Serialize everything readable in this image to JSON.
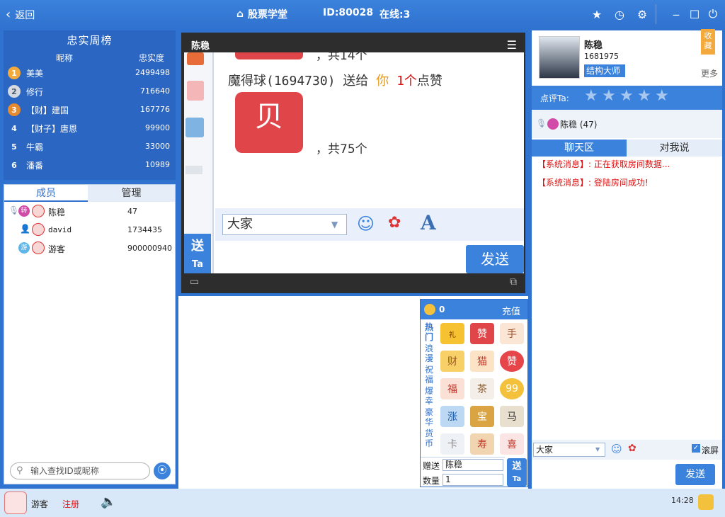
{
  "topbar": {
    "back_label": "返回",
    "title": "股票学堂",
    "room_id": "ID:80028",
    "online": "在线:3",
    "icons": [
      "star-icon",
      "clock-icon",
      "settings-icon",
      "minimize-icon",
      "maximize-icon",
      "power-icon"
    ]
  },
  "leaderboard": {
    "title": "忠实周榜",
    "col_name": "昵称",
    "col_score": "忠实度",
    "rows": [
      {
        "rank": "1",
        "name": "美美",
        "score": "2499498"
      },
      {
        "rank": "2",
        "name": "修行",
        "score": "716640"
      },
      {
        "rank": "3",
        "name": "【财】建国",
        "score": "167776"
      },
      {
        "rank": "4",
        "name": "【财子】唐恩",
        "score": "99900"
      },
      {
        "rank": "5",
        "name": "牛霸",
        "score": "33000"
      },
      {
        "rank": "6",
        "name": "潘番",
        "score": "10989"
      }
    ]
  },
  "members": {
    "tab_members": "成员",
    "tab_manage": "管理",
    "rows": [
      {
        "name": "陈稳",
        "id": "47",
        "badge": "转"
      },
      {
        "name": "david",
        "id": "1734435",
        "badge": ""
      },
      {
        "name": "游客",
        "id": "900000940",
        "badge": "游"
      }
    ],
    "search_placeholder": "输入查找ID或昵称"
  },
  "video": {
    "title": "陈稳",
    "screen": {
      "line1": "，共14个",
      "gift_line": "魔得球(1694730) 送给",
      "gift_target": "你",
      "gift_count": "1个",
      "gift_name": "点赞",
      "line2": "，共75个",
      "chat_target": "大家",
      "send_label": "发送",
      "side_send": "送",
      "side_ta": "Ta"
    }
  },
  "gifts": {
    "balance": "0",
    "recharge": "充值",
    "categories": [
      "热门",
      "浪漫",
      "祝福",
      "爆幸",
      "豪华",
      "货币"
    ],
    "give_label": "赠送",
    "give_target": "陈稳",
    "qty_label": "数量",
    "qty_value": "1",
    "send_label": "送",
    "send_ta": "Ta",
    "items": [
      "礼",
      "赞",
      "手",
      "财",
      "猫",
      "赞",
      "福",
      "茶",
      "99",
      "涨",
      "宝",
      "马",
      "卡",
      "寿",
      "喜"
    ]
  },
  "profile": {
    "name": "陈稳",
    "id": "1681975",
    "title": "结构大师",
    "more": "更多",
    "collect": "收藏",
    "rate_label": "点评Ta:",
    "stars": 5
  },
  "chat": {
    "speaker_name": "陈稳 (47)",
    "tab_chat": "聊天区",
    "tab_private": "对我说",
    "messages": [
      {
        "tag": "【系统消息】:",
        "text": "正在获取房间数据..."
      },
      {
        "tag": "【系统消息】:",
        "text": "登陆房间成功!"
      }
    ],
    "target": "大家",
    "scroll_label": "滚屏",
    "send_label": "发送"
  },
  "bottombar": {
    "user": "游客",
    "register": "注册",
    "time": "14:28"
  },
  "colors": {
    "primary": "#3b82dc",
    "dark": "#2b66c2",
    "system": "#d11111",
    "gold": "#f3a93c"
  }
}
